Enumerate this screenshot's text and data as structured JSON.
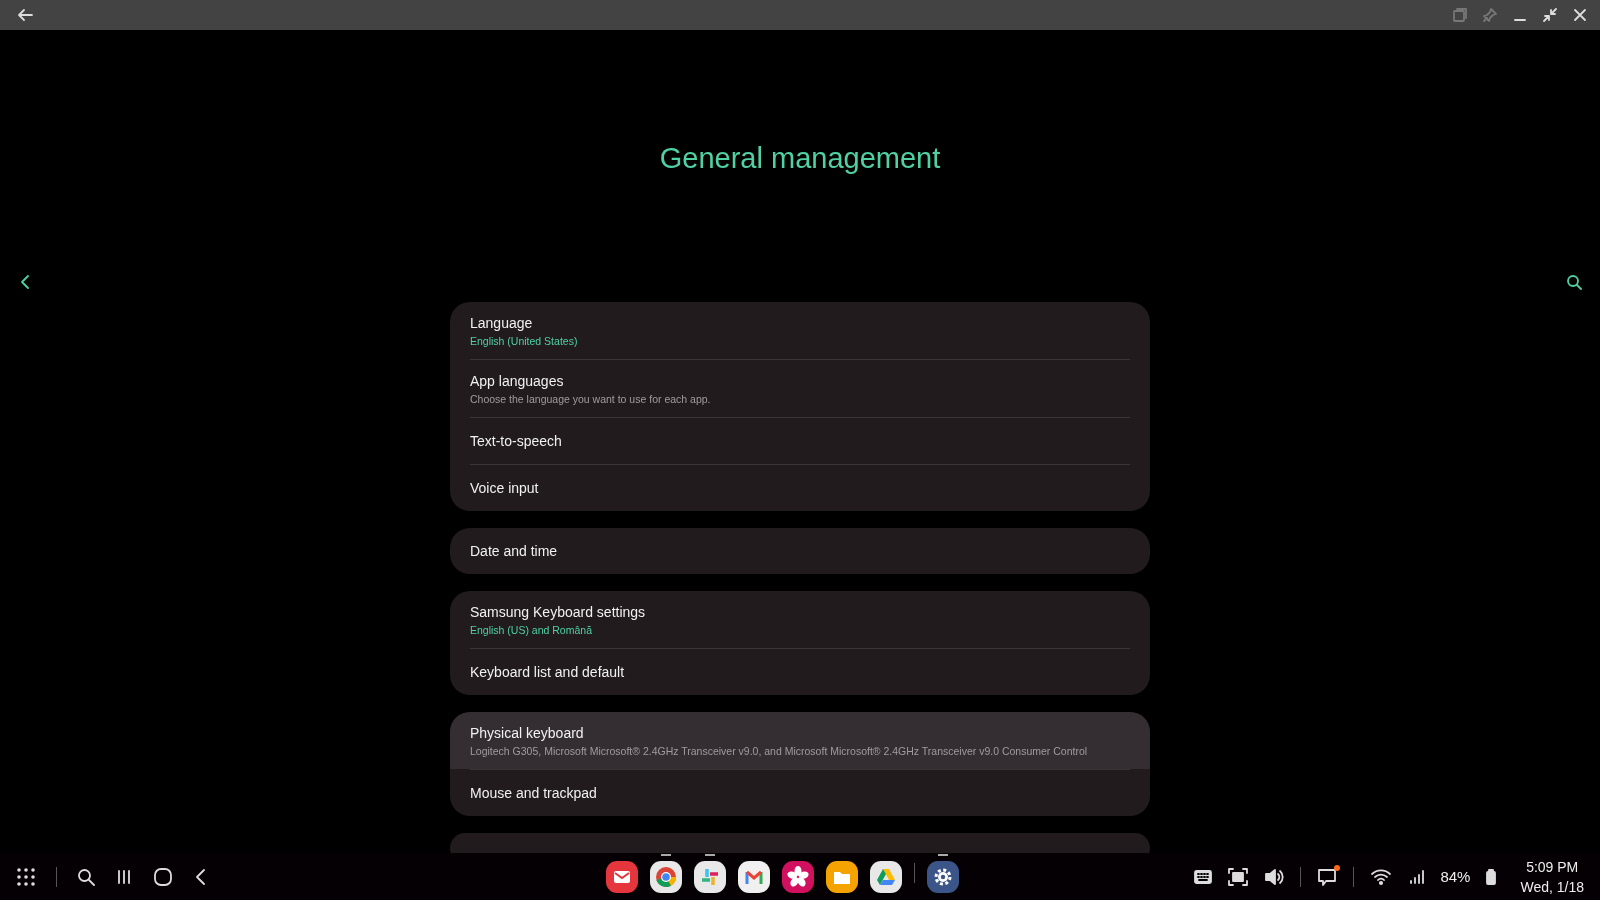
{
  "header": {
    "title": "General management"
  },
  "groups": [
    {
      "items": [
        {
          "title": "Language",
          "subtitle": "English (United States)",
          "kind": "value",
          "selected": false
        },
        {
          "title": "App languages",
          "subtitle": "Choose the language you want to use for each app.",
          "kind": "description",
          "selected": false
        },
        {
          "title": "Text-to-speech",
          "kind": "plain",
          "selected": false
        },
        {
          "title": "Voice input",
          "kind": "plain",
          "selected": false
        }
      ]
    },
    {
      "items": [
        {
          "title": "Date and time",
          "kind": "plain",
          "selected": false
        }
      ]
    },
    {
      "items": [
        {
          "title": "Samsung Keyboard settings",
          "subtitle": "English (US) and Română",
          "kind": "value",
          "selected": false
        },
        {
          "title": "Keyboard list and default",
          "kind": "plain",
          "selected": false
        }
      ]
    },
    {
      "items": [
        {
          "title": "Physical keyboard",
          "subtitle": "Logitech G305, Microsoft Microsoft® 2.4GHz Transceiver v9.0, and Microsoft Microsoft® 2.4GHz Transceiver v9.0 Consumer Control",
          "kind": "description",
          "selected": true
        },
        {
          "title": "Mouse and trackpad",
          "kind": "plain",
          "selected": false
        }
      ]
    },
    {
      "kind": "cut_off"
    }
  ],
  "taskbar": {
    "apps": [
      {
        "kind": "mail",
        "running": false
      },
      {
        "kind": "chrome",
        "running": true
      },
      {
        "kind": "slack",
        "running": true
      },
      {
        "kind": "gmail",
        "running": false
      },
      {
        "kind": "flower",
        "running": false
      },
      {
        "kind": "files",
        "running": false
      },
      {
        "kind": "drive",
        "running": false
      },
      {
        "kind": "settings",
        "running": true
      }
    ],
    "notification": true,
    "battery": "84%",
    "time": "5:09 PM",
    "date": "Wed, 1/18"
  }
}
